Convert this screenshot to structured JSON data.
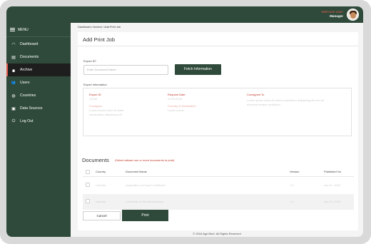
{
  "header": {
    "welcome_text": "Welcome user!",
    "role": "Manager"
  },
  "sidebar": {
    "menu_label": "MENU",
    "items": [
      {
        "label": "Dashboard",
        "icon": "gauge-icon",
        "glyph": "◠"
      },
      {
        "label": "Documents",
        "icon": "document-icon",
        "glyph": "▤"
      },
      {
        "label": "Archive",
        "icon": "archive-icon",
        "glyph": "▆",
        "active": true
      },
      {
        "label": "Users",
        "icon": "users-icon",
        "glyph": "👥"
      },
      {
        "label": "Countries",
        "icon": "globe-icon",
        "glyph": "◍"
      },
      {
        "label": "Data Sources",
        "icon": "database-icon",
        "glyph": "▣"
      },
      {
        "label": "Log Out",
        "icon": "power-icon",
        "glyph": "⏻"
      }
    ]
  },
  "breadcrumb": "Dashboard  /  Archive  /  Add Print Job",
  "page_title": "Add Print Job",
  "form": {
    "export_id_label": "Export ID",
    "export_id_required": "*",
    "export_id_placeholder": "Enter Document Name",
    "fetch_button": "Fetch Information",
    "export_info_label": "Export Information"
  },
  "export_info": {
    "export_id_heading": "Export ID",
    "export_id_value": "12345",
    "request_date_heading": "Request Date",
    "request_date_value": "01/01/2018",
    "consigned_to_heading": "Consigned To",
    "consigned_to_value": "Lorem ipsum dolor sit amet consectetur adipiscing elit sed do eiusmod tempor incididunt",
    "consignor_heading": "Consignor",
    "consignor_value": "Lorem ipsum dolor sit amet consectetur adipiscing elit",
    "country_heading": "Country of Destination",
    "country_value": "Lorem ipsum"
  },
  "documents": {
    "title": "Documents",
    "note": "(Select atleast one or more documents to print)",
    "columns": [
      "Country",
      "Document Name",
      "Version",
      "Published On"
    ],
    "rows": [
      {
        "country": "Canada",
        "name": "Application of Export Certificate",
        "version": "1.0",
        "published": "Jan 01, 2018"
      },
      {
        "country": "Canada",
        "name": "Certificate of Wholesomeness",
        "version": "1.0",
        "published": "Jan 01, 2018"
      }
    ]
  },
  "actions": {
    "cancel": "Cancel",
    "print": "Print"
  },
  "footer": "© 2018 Agri Beef. All Rights Reserved",
  "colors": {
    "brand_green": "#2f4a3a",
    "accent_red": "#e05a4a"
  }
}
